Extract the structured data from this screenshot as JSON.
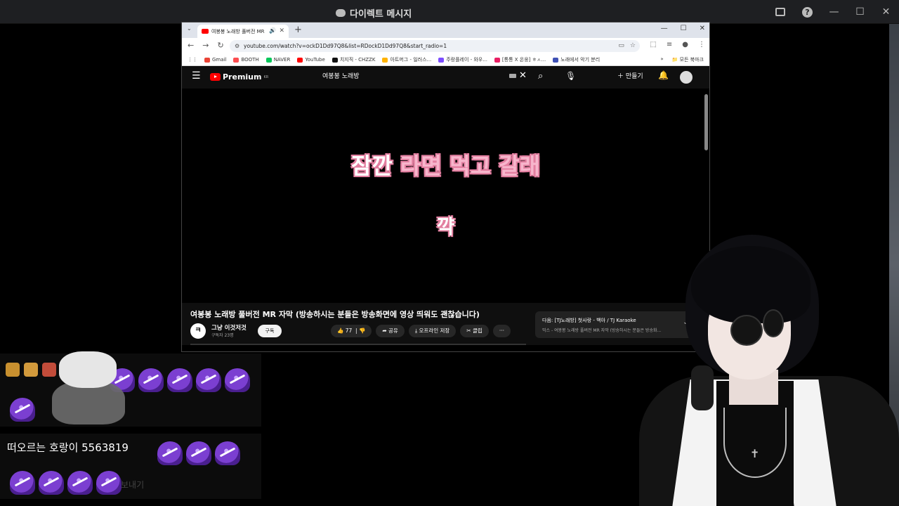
{
  "discord": {
    "title": "다이렉트 메시지"
  },
  "browser": {
    "tab_title": "여봉봉 노래방 풀버전 MR",
    "url": "youtube.com/watch?v=ockD1Dd97Q8&list=RDockD1Dd97Q8&start_radio=1",
    "bookmarks": [
      {
        "label": "Gmail",
        "color": "#ea4335"
      },
      {
        "label": "BOOTH",
        "color": "#fc4d50"
      },
      {
        "label": "NAVER",
        "color": "#03c75a"
      },
      {
        "label": "YouTube",
        "color": "#ff0000"
      },
      {
        "label": "치지직 - CHZZK",
        "color": "#111111"
      },
      {
        "label": "아트머그 - 일러스...",
        "color": "#ffb300"
      },
      {
        "label": "주랑플레이 - 와우...",
        "color": "#7c4dff"
      },
      {
        "label": "[통통 X 온웅] ㅎㅅ...",
        "color": "#e91e63"
      },
      {
        "label": "노래에서 악기 분리",
        "color": "#3f51b5"
      }
    ],
    "all_bookmarks": "모든 북마크"
  },
  "youtube": {
    "logo_text": "Premium",
    "region": "KR",
    "search_value": "여봉봉 노래방",
    "create_label": "만들기",
    "lyrics": {
      "line1_white": "잠깐 ",
      "line1_pink": "라면 먹고 갈래",
      "line2": "꺅"
    },
    "video_title": "여봉봉 노래방 풀버전 MR 자막 (방송하시는 분들은 방송화면에 영상 띄워도 괜찮습니다)",
    "channel_initial": "ㅋ",
    "channel_name": "그냥 이것저것",
    "channel_subs": "구독자 23명",
    "subscribe_label": "구독",
    "like_count": "77",
    "share_label": "공유",
    "offline_label": "오프라인 저장",
    "clip_label": "클립",
    "more_label": "···",
    "next_title": "다음: [TJ노래방] 첫사랑 - 백아 / TJ Karaoke",
    "next_sub": "믹스 - 여봉봉 노래방 풀버전 MR 자막 (방송하시는 분들은 방송화..."
  },
  "chat": {
    "message": "떠오르는 호랑이 5563819",
    "faded": "보내기"
  },
  "colors": {
    "lyric_outline": "#e37fa0",
    "emote_purple": "#7b3fd1",
    "yt_red": "#ff0000"
  }
}
